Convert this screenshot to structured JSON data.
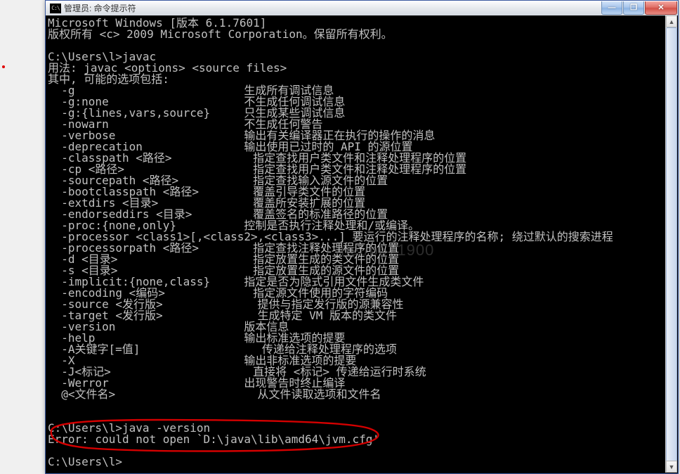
{
  "titlebar": {
    "icon_label": "C:\\",
    "title": "管理员: 命令提示符"
  },
  "win_buttons": {
    "minimize": "—",
    "maximize": "❐",
    "close": "✕"
  },
  "scrollbar": {
    "up": "▲",
    "down": "▼"
  },
  "watermark": "net/b671900",
  "terminal": {
    "lines": [
      "Microsoft Windows [版本 6.1.7601]",
      "版权所有 <c> 2009 Microsoft Corporation。保留所有权利。",
      "",
      "C:\\Users\\l>javac",
      "用法: javac <options> <source files>",
      "其中, 可能的选项包括:",
      "  -g                         生成所有调试信息",
      "  -g:none                    不生成任何调试信息",
      "  -g:{lines,vars,source}     只生成某些调试信息",
      "  -nowarn                    不生成任何警告",
      "  -verbose                   输出有关编译器正在执行的操作的消息",
      "  -deprecation               输出使用已过时的 API 的源位置",
      "  -classpath <路径>            指定查找用户类文件和注释处理程序的位置",
      "  -cp <路径>                   指定查找用户类文件和注释处理程序的位置",
      "  -sourcepath <路径>           指定查找输入源文件的位置",
      "  -bootclasspath <路径>        覆盖引导类文件的位置",
      "  -extdirs <目录>              覆盖所安装扩展的位置",
      "  -endorseddirs <目录>         覆盖签名的标准路径的位置",
      "  -proc:{none,only}          控制是否执行注释处理和/或编译。",
      "  -processor <class1>[,<class2>,<class3>...] 要运行的注释处理程序的名称; 绕过默认的搜索进程",
      "  -processorpath <路径>        指定查找注释处理程序的位置",
      "  -d <目录>                    指定放置生成的类文件的位置",
      "  -s <目录>                    指定放置生成的源文件的位置",
      "  -implicit:{none,class}     指定是否为隐式引用文件生成类文件",
      "  -encoding <编码>             指定源文件使用的字符编码",
      "  -source <发行版>              提供与指定发行版的源兼容性",
      "  -target <发行版>              生成特定 VM 版本的类文件",
      "  -version                   版本信息",
      "  -help                      输出标准选项的提要",
      "  -A关键字[=值]                  传递给注释处理程序的选项",
      "  -X                         输出非标准选项的提要",
      "  -J<标记>                     直接将 <标记> 传递给运行时系统",
      "  -Werror                    出现警告时终止编译",
      "  @<文件名>                     从文件读取选项和文件名",
      "",
      "",
      "C:\\Users\\l>java -version",
      "Error: could not open `D:\\java\\lib\\amd64\\jvm.cfg'",
      "",
      "C:\\Users\\l>"
    ]
  }
}
